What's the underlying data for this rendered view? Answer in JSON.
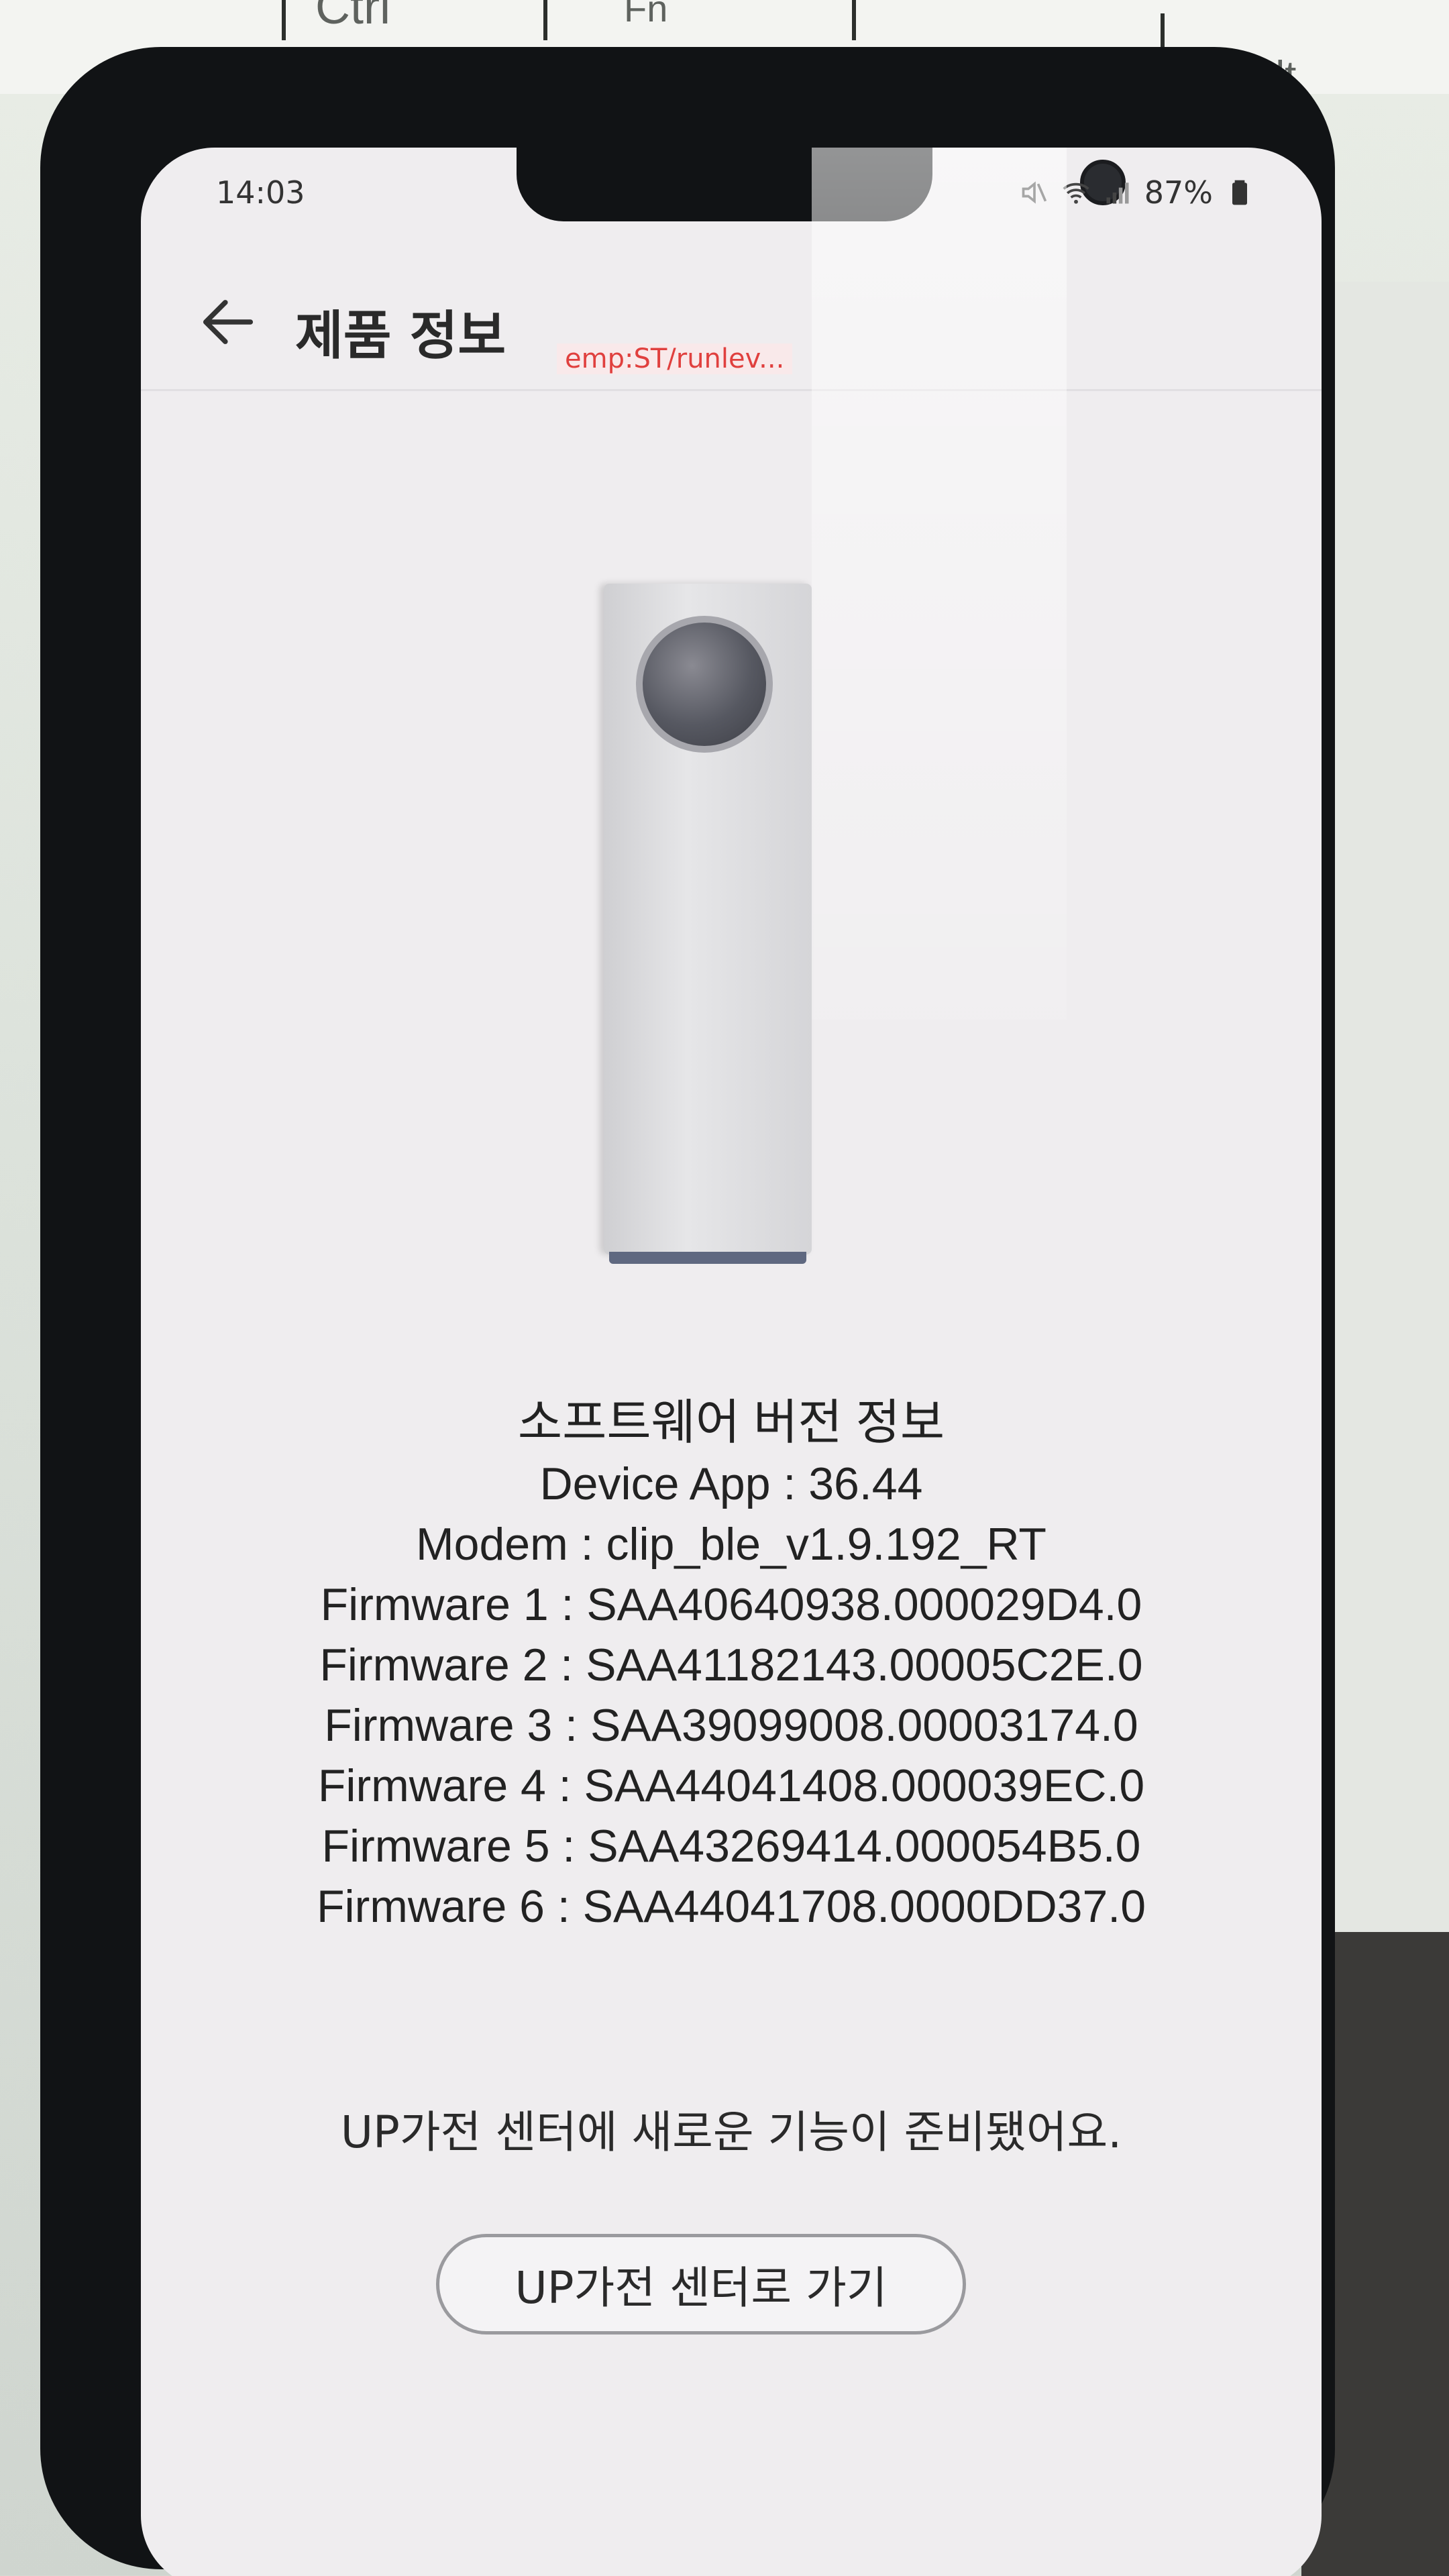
{
  "background": {
    "keyboard_keys": [
      "Ctrl",
      "Fn",
      "Alt"
    ]
  },
  "status_bar": {
    "time": "14:03",
    "battery": "87%",
    "icons": [
      "mute-icon",
      "wifi-icon",
      "signal-icon",
      "battery-icon"
    ]
  },
  "header": {
    "title": "제품 정보",
    "debug_overlay": "emp:ST/runlev..."
  },
  "device_image": {
    "icon": "device-remote-icon"
  },
  "software": {
    "title": "소프트웨어 버전 정보",
    "lines": [
      "Device App : 36.44",
      "Modem : clip_ble_v1.9.192_RT",
      "Firmware 1 : SAA40640938.000029D4.0",
      "Firmware 2 : SAA41182143.00005C2E.0",
      "Firmware 3 : SAA39099008.00003174.0",
      "Firmware 4 : SAA44041408.000039EC.0",
      "Firmware 5 : SAA43269414.000054B5.0",
      "Firmware 6 : SAA44041708.0000DD37.0"
    ]
  },
  "notice": "UP가전 센터에 새로운 기능이 준비됐어요.",
  "cta_button": "UP가전 센터로 가기"
}
